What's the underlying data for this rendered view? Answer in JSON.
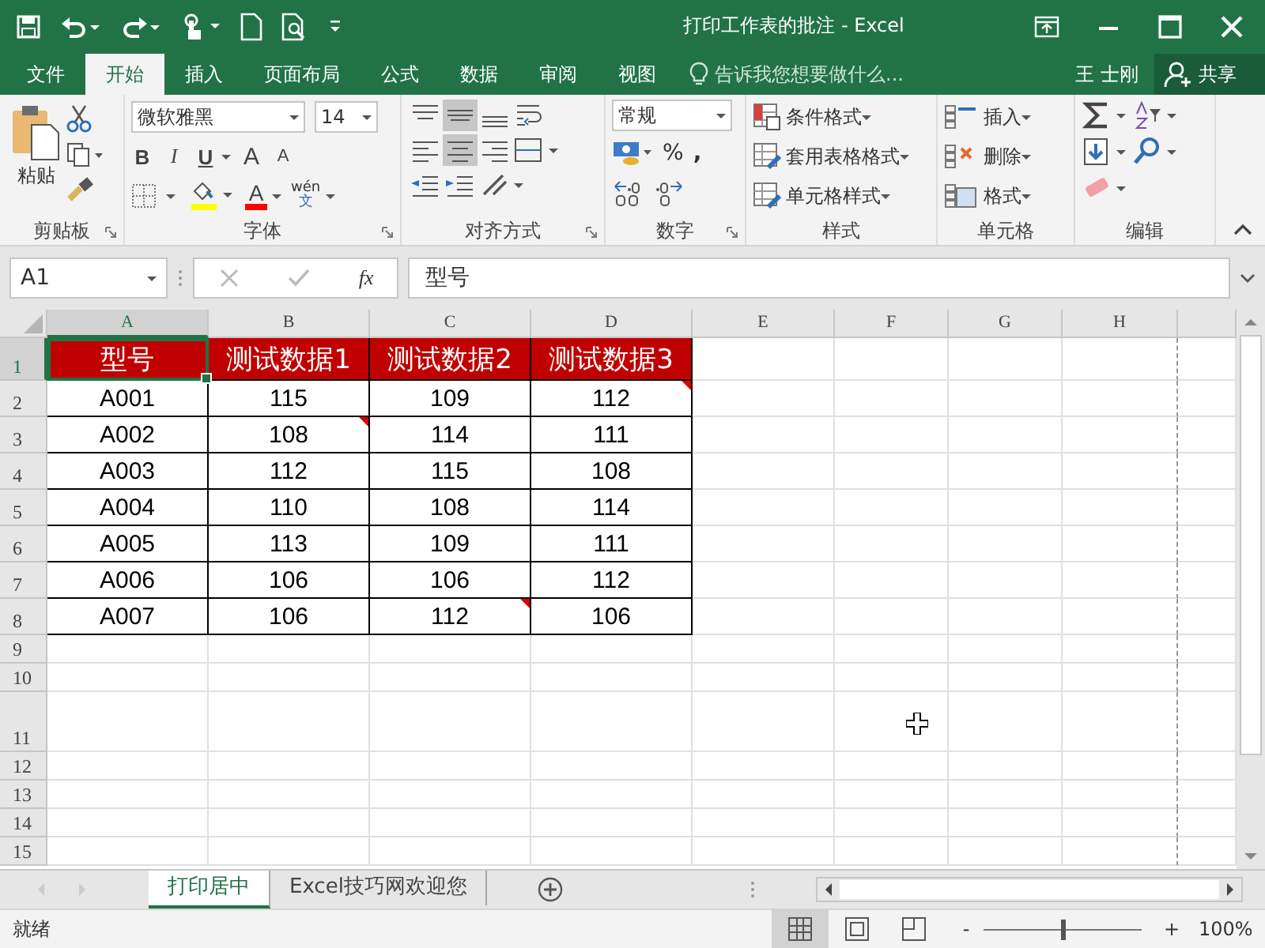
{
  "title_bar": {
    "title": "打印工作表的批注 - Excel"
  },
  "menu_tabs": [
    {
      "label": "文件",
      "selected": false
    },
    {
      "label": "开始",
      "selected": true
    },
    {
      "label": "插入",
      "selected": false
    },
    {
      "label": "页面布局",
      "selected": false
    },
    {
      "label": "公式",
      "selected": false
    },
    {
      "label": "数据",
      "selected": false
    },
    {
      "label": "审阅",
      "selected": false
    },
    {
      "label": "视图",
      "selected": false
    }
  ],
  "tell_me": {
    "placeholder": "告诉我您想要做什么..."
  },
  "user": "王 士刚",
  "share": "共享",
  "ribbon": {
    "clipboard": {
      "paste": "粘贴",
      "label": "剪贴板"
    },
    "font": {
      "font_name": "微软雅黑",
      "font_size": "14",
      "bold": "B",
      "italic": "I",
      "underline": "U",
      "grow": "A",
      "shrink": "A",
      "font_color": "A",
      "phonetic_top": "wén",
      "phonetic_bottom": "文",
      "label": "字体"
    },
    "alignment": {
      "label": "对齐方式"
    },
    "number": {
      "format": "常规",
      "percent": "%",
      "comma": ",",
      "label": "数字"
    },
    "styles": {
      "items": [
        "条件格式",
        "套用表格格式",
        "单元格样式"
      ],
      "label": "样式"
    },
    "cells": {
      "items": [
        "插入",
        "删除",
        "格式"
      ],
      "label": "单元格"
    },
    "editing": {
      "label": "编辑"
    }
  },
  "formula_bar": {
    "name_box": "A1",
    "fx": "fx",
    "formula": "型号"
  },
  "columns": [
    {
      "label": "A",
      "selected": true
    },
    {
      "label": "B",
      "selected": false
    },
    {
      "label": "C",
      "selected": false
    },
    {
      "label": "D",
      "selected": false
    },
    {
      "label": "E",
      "selected": false
    },
    {
      "label": "F",
      "selected": false
    },
    {
      "label": "G",
      "selected": false
    },
    {
      "label": "H",
      "selected": false
    }
  ],
  "rows": [
    {
      "number": "1",
      "selected": true,
      "kind": "header",
      "cells": [
        {
          "text": "型号",
          "comment": false
        },
        {
          "text": "测试数据1",
          "comment": false
        },
        {
          "text": "测试数据2",
          "comment": false
        },
        {
          "text": "测试数据3",
          "comment": false
        }
      ]
    },
    {
      "number": "2",
      "selected": false,
      "kind": "data",
      "cells": [
        {
          "text": "A001",
          "comment": false
        },
        {
          "text": "115",
          "comment": false
        },
        {
          "text": "109",
          "comment": false
        },
        {
          "text": "112",
          "comment": true
        }
      ]
    },
    {
      "number": "3",
      "selected": false,
      "kind": "data",
      "cells": [
        {
          "text": "A002",
          "comment": false
        },
        {
          "text": "108",
          "comment": true
        },
        {
          "text": "114",
          "comment": false
        },
        {
          "text": "111",
          "comment": false
        }
      ]
    },
    {
      "number": "4",
      "selected": false,
      "kind": "data",
      "cells": [
        {
          "text": "A003",
          "comment": false
        },
        {
          "text": "112",
          "comment": false
        },
        {
          "text": "115",
          "comment": false
        },
        {
          "text": "108",
          "comment": false
        }
      ]
    },
    {
      "number": "5",
      "selected": false,
      "kind": "data",
      "cells": [
        {
          "text": "A004",
          "comment": false
        },
        {
          "text": "110",
          "comment": false
        },
        {
          "text": "108",
          "comment": false
        },
        {
          "text": "114",
          "comment": false
        }
      ]
    },
    {
      "number": "6",
      "selected": false,
      "kind": "data",
      "cells": [
        {
          "text": "A005",
          "comment": false
        },
        {
          "text": "113",
          "comment": false
        },
        {
          "text": "109",
          "comment": false
        },
        {
          "text": "111",
          "comment": false
        }
      ]
    },
    {
      "number": "7",
      "selected": false,
      "kind": "data",
      "cells": [
        {
          "text": "A006",
          "comment": false
        },
        {
          "text": "106",
          "comment": false
        },
        {
          "text": "106",
          "comment": false
        },
        {
          "text": "112",
          "comment": false
        }
      ]
    },
    {
      "number": "8",
      "selected": false,
      "kind": "data",
      "cells": [
        {
          "text": "A007",
          "comment": false
        },
        {
          "text": "106",
          "comment": false
        },
        {
          "text": "112",
          "comment": true
        },
        {
          "text": "106",
          "comment": false
        }
      ]
    },
    {
      "number": "9",
      "selected": false,
      "kind": "empty"
    },
    {
      "number": "10",
      "selected": false,
      "kind": "empty"
    },
    {
      "number": "11",
      "selected": false,
      "kind": "tall"
    },
    {
      "number": "12",
      "selected": false,
      "kind": "empty"
    },
    {
      "number": "13",
      "selected": false,
      "kind": "empty"
    },
    {
      "number": "14",
      "selected": false,
      "kind": "empty"
    },
    {
      "number": "15",
      "selected": false,
      "kind": "empty"
    }
  ],
  "sheet_tabs": [
    {
      "label": "打印居中",
      "selected": true
    },
    {
      "label": "Excel技巧网欢迎您",
      "selected": false
    }
  ],
  "status_bar": {
    "status": "就绪",
    "zoom": "100%",
    "zoom_minus": "-",
    "zoom_plus": "+",
    "level": 0.5
  }
}
